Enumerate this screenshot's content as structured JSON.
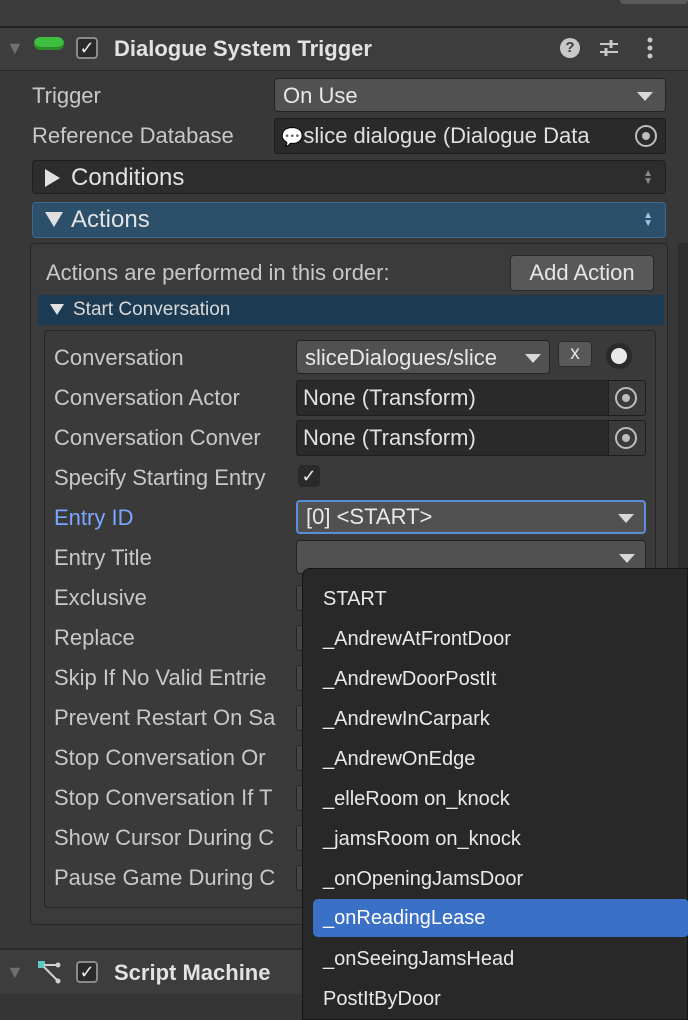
{
  "component": {
    "title": "Dialogue System Trigger",
    "enabled": true
  },
  "fields": {
    "trigger": {
      "label": "Trigger",
      "value": "On Use"
    },
    "reference_database": {
      "label": "Reference Database",
      "value": "slice dialogue (Dialogue Data"
    }
  },
  "foldouts": {
    "conditions": "Conditions",
    "actions": "Actions"
  },
  "actions_panel": {
    "info": "Actions are performed in this order:",
    "add_action": "Add Action",
    "start_conversation": {
      "header": "Start Conversation",
      "conversation": {
        "label": "Conversation",
        "value": "sliceDialogues/slice",
        "clear": "x"
      },
      "conversation_actor": {
        "label": "Conversation Actor",
        "value": "None (Transform)"
      },
      "conversation_conversant": {
        "label": "Conversation Conver",
        "value": "None (Transform)"
      },
      "specify_starting_entry": {
        "label": "Specify Starting Entry",
        "checked": true
      },
      "entry_id": {
        "label": "Entry ID",
        "value": "[0] <START>"
      },
      "entry_title": {
        "label": "Entry Title",
        "value": ""
      },
      "rows": [
        "Exclusive",
        "Replace",
        "Skip If No Valid Entrie",
        "Prevent Restart On Sa",
        "Stop Conversation Or",
        "Stop Conversation If T",
        "Show Cursor During C",
        "Pause Game During C"
      ]
    }
  },
  "dropdown": {
    "items": [
      "START",
      "_AndrewAtFrontDoor",
      "_AndrewDoorPostIt",
      "_AndrewInCarpark",
      "_AndrewOnEdge",
      "_elleRoom on_knock",
      "_jamsRoom on_knock",
      "_onOpeningJamsDoor",
      "_onReadingLease",
      "_onSeeingJamsHead",
      "PostItByDoor"
    ],
    "selected": "_onReadingLease"
  },
  "next_component": {
    "title": "Script Machine",
    "enabled": true
  },
  "colors": {
    "selection": "#3a70c6",
    "accent_label": "#7ba6ff",
    "actions_bar": "#2c4f6a",
    "badge": "#3fbf3f"
  }
}
